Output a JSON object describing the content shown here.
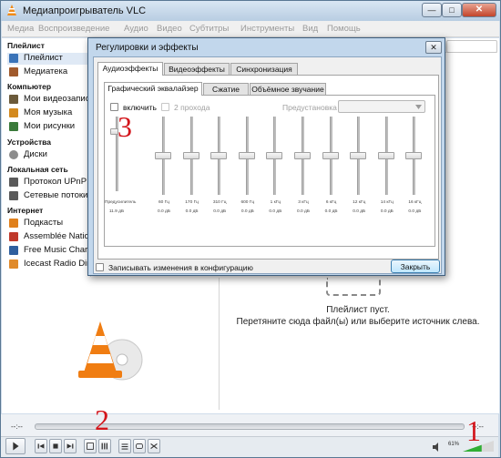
{
  "window": {
    "title": "Медиапроигрыватель VLC",
    "minimize_glyph": "—",
    "maximize_glyph": "□",
    "close_glyph": "✕"
  },
  "menu": [
    "Медиа",
    "Воспроизведение",
    "Аудио",
    "Видео",
    "Субтитры",
    "Инструменты",
    "Вид",
    "Помощь"
  ],
  "sidebar": {
    "sections": [
      {
        "title": "Плейлист",
        "items": [
          {
            "label": "Плейлист",
            "icon": "playlist-icon",
            "color": "#3a73b8",
            "selected": true
          },
          {
            "label": "Медиатека",
            "icon": "library-icon",
            "color": "#a05a2c"
          }
        ]
      },
      {
        "title": "Компьютер",
        "items": [
          {
            "label": "Мои видеозаписи",
            "icon": "video-folder-icon",
            "color": "#6b5a3a"
          },
          {
            "label": "Моя музыка",
            "icon": "music-folder-icon",
            "color": "#d38a1f"
          },
          {
            "label": "Мои рисунки",
            "icon": "pictures-folder-icon",
            "color": "#3a7a3a"
          }
        ]
      },
      {
        "title": "Устройства",
        "items": [
          {
            "label": "Диски",
            "icon": "disc-icon",
            "color": "#8c8c8c"
          }
        ]
      },
      {
        "title": "Локальная сеть",
        "items": [
          {
            "label": "Протокол UPnP",
            "icon": "network-icon",
            "color": "#5a5a5a"
          },
          {
            "label": "Сетевые потоки (SAP)",
            "icon": "network-streams-icon",
            "color": "#5a5a5a"
          }
        ]
      },
      {
        "title": "Интернет",
        "items": [
          {
            "label": "Подкасты",
            "icon": "podcast-icon",
            "color": "#e0801c"
          },
          {
            "label": "Assemblée Nationale",
            "icon": "assemblee-icon",
            "color": "#c0392b"
          },
          {
            "label": "Free Music Charts",
            "icon": "music-charts-icon",
            "color": "#2f5f9e"
          },
          {
            "label": "Icecast Radio Directory",
            "icon": "icecast-icon",
            "color": "#e08a2a"
          }
        ]
      }
    ]
  },
  "playlist": {
    "empty_line1": "Плейлист пуст.",
    "empty_line2": "Перетяните сюда файл(ы) или выберите источник слева."
  },
  "player": {
    "time_elapsed": "--:--",
    "time_total": "--:--",
    "volume_label": "61%",
    "volume": 0.61
  },
  "annotations": [
    "1",
    "2",
    "3"
  ],
  "dialog": {
    "title": "Регулировки и эффекты",
    "close_glyph": "✕",
    "tabs": [
      "Аудиоэффекты",
      "Видеоэффекты",
      "Синхронизация"
    ],
    "active_tab": 0,
    "subtabs": [
      "Графический эквалайзер",
      "Сжатие",
      "Объёмное звучание"
    ],
    "active_subtab": 0,
    "enable_label": "включить",
    "two_pass_label": "2 прохода",
    "preset_label": "Предустановка",
    "preamp_label": "Предусилитель",
    "preamp_value": "11.9 дБ",
    "bands": [
      {
        "freq": "60 Гц",
        "value": "0.0 дБ"
      },
      {
        "freq": "170 Гц",
        "value": "0.0 дБ"
      },
      {
        "freq": "310 Гц",
        "value": "0.0 дБ"
      },
      {
        "freq": "600 Гц",
        "value": "0.0 дБ"
      },
      {
        "freq": "1 кГц",
        "value": "0.0 дБ"
      },
      {
        "freq": "3 кГц",
        "value": "0.0 дБ"
      },
      {
        "freq": "6 кГц",
        "value": "0.0 дБ"
      },
      {
        "freq": "12 кГц",
        "value": "0.0 дБ"
      },
      {
        "freq": "14 кГц",
        "value": "0.0 дБ"
      },
      {
        "freq": "16 кГц",
        "value": "0.0 дБ"
      }
    ],
    "save_config_label": "Записывать изменения в конфигурацию",
    "close_button": "Закрыть"
  }
}
